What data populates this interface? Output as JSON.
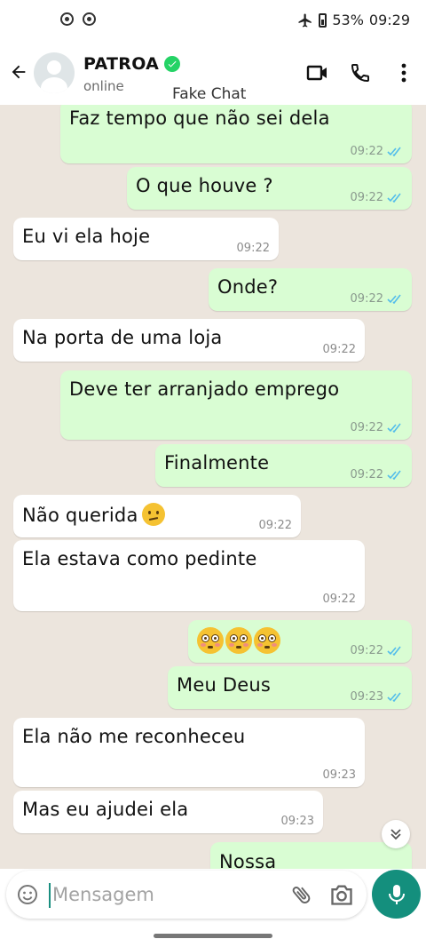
{
  "status_bar": {
    "battery": "53%",
    "time": "09:29",
    "icons": [
      "record-icon",
      "record-icon",
      "airplane-icon",
      "battery-icon"
    ]
  },
  "header": {
    "contact_name": "PATROA",
    "status": "online",
    "overlay_label": "Fake Chat",
    "icons": [
      "back-arrow-icon",
      "verified-icon",
      "video-call-icon",
      "phone-icon",
      "more-options-icon"
    ]
  },
  "messages": [
    {
      "direction": "out",
      "text": "Faz tempo que não sei dela",
      "time": "09:22",
      "read": true
    },
    {
      "direction": "out",
      "text": "O que houve ?",
      "time": "09:22",
      "read": true
    },
    {
      "direction": "in",
      "text": "Eu vi ela hoje",
      "time": "09:22"
    },
    {
      "direction": "out",
      "text": "Onde?",
      "time": "09:22",
      "read": true
    },
    {
      "direction": "in",
      "text": "Na porta de uma loja",
      "time": "09:22"
    },
    {
      "direction": "out",
      "text": "Deve ter arranjado emprego",
      "time": "09:22",
      "read": true
    },
    {
      "direction": "out",
      "text": "Finalmente",
      "time": "09:22",
      "read": true
    },
    {
      "direction": "in",
      "text": "Não querida",
      "emoji": "confused-face",
      "time": "09:22"
    },
    {
      "direction": "in",
      "text": "Ela estava como pedinte",
      "time": "09:22"
    },
    {
      "direction": "out",
      "text": "",
      "emoji": "flushed-face x3",
      "time": "09:22",
      "read": true
    },
    {
      "direction": "out",
      "text": "Meu Deus",
      "time": "09:23",
      "read": true
    },
    {
      "direction": "in",
      "text": "Ela não me reconheceu",
      "time": "09:23"
    },
    {
      "direction": "in",
      "text": "Mas eu ajudei ela",
      "time": "09:23"
    },
    {
      "direction": "out",
      "text": "Nossa",
      "time": "",
      "read": false
    }
  ],
  "composer": {
    "placeholder": "Mensagem",
    "icons": [
      "emoji-icon",
      "attach-icon",
      "camera-icon",
      "mic-icon"
    ]
  },
  "colors": {
    "outgoing_bubble": "#d9fdd3",
    "incoming_bubble": "#ffffff",
    "chat_background": "#ece5dd",
    "read_ticks": "#53bdeb",
    "accent": "#148f7d",
    "verified": "#25d366"
  }
}
